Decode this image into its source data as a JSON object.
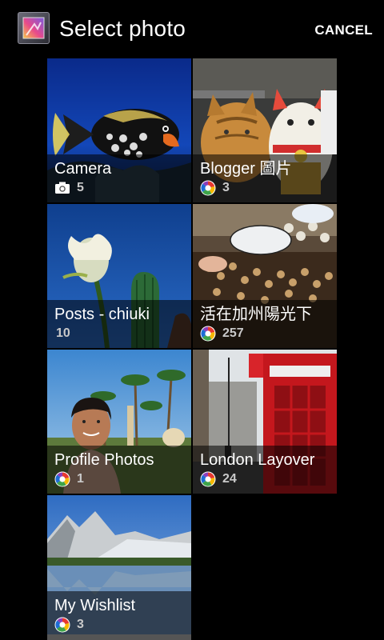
{
  "header": {
    "title": "Select photo",
    "cancel_label": "CANCEL"
  },
  "albums": [
    {
      "name": "Camera",
      "count": "5",
      "source_icon": "camera-icon"
    },
    {
      "name": "Blogger 圖片",
      "count": "3",
      "source_icon": "picasa-icon"
    },
    {
      "name": "Posts - chiuki",
      "count": "10",
      "source_icon": ""
    },
    {
      "name": "活在加州陽光下",
      "count": "257",
      "source_icon": "picasa-icon"
    },
    {
      "name": "Profile Photos",
      "count": "1",
      "source_icon": "picasa-icon"
    },
    {
      "name": "London Layover",
      "count": "24",
      "source_icon": "picasa-icon"
    },
    {
      "name": "My Wishlist",
      "count": "3",
      "source_icon": "picasa-icon"
    }
  ],
  "colors": {
    "background": "#000000",
    "text": "#ffffff",
    "count_text": "#c9c9c9"
  }
}
